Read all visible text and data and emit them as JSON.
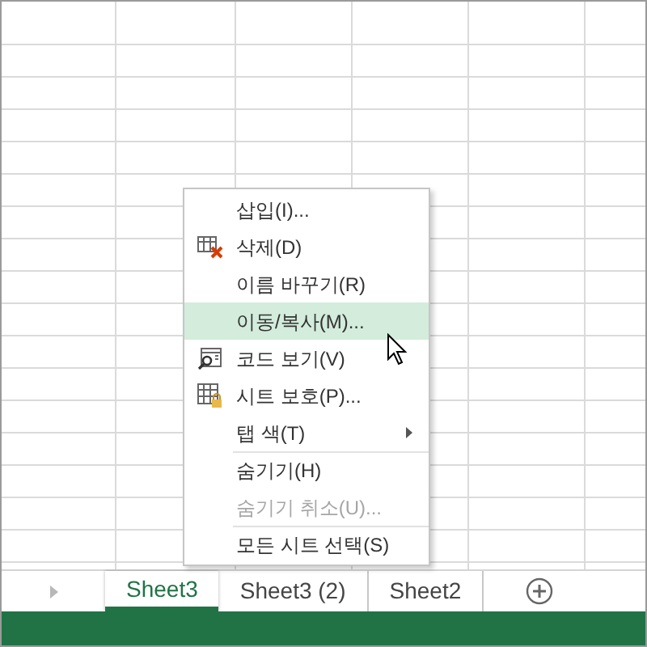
{
  "context_menu": {
    "items": [
      {
        "label": "삽입(I)...",
        "kind": "plain",
        "disabled": false,
        "selected": false,
        "submenu": false,
        "separator_before": false
      },
      {
        "label": "삭제(D)",
        "kind": "delete",
        "disabled": false,
        "selected": false,
        "submenu": false,
        "separator_before": false
      },
      {
        "label": "이름 바꾸기(R)",
        "kind": "plain",
        "disabled": false,
        "selected": false,
        "submenu": false,
        "separator_before": false
      },
      {
        "label": "이동/복사(M)...",
        "kind": "plain",
        "disabled": false,
        "selected": true,
        "submenu": false,
        "separator_before": false
      },
      {
        "label": "코드 보기(V)",
        "kind": "code",
        "disabled": false,
        "selected": false,
        "submenu": false,
        "separator_before": false
      },
      {
        "label": "시트 보호(P)...",
        "kind": "protect",
        "disabled": false,
        "selected": false,
        "submenu": false,
        "separator_before": false
      },
      {
        "label": "탭 색(T)",
        "kind": "plain",
        "disabled": false,
        "selected": false,
        "submenu": true,
        "separator_before": false
      },
      {
        "label": "숨기기(H)",
        "kind": "plain",
        "disabled": false,
        "selected": false,
        "submenu": false,
        "separator_before": true
      },
      {
        "label": "숨기기 취소(U)...",
        "kind": "plain",
        "disabled": true,
        "selected": false,
        "submenu": false,
        "separator_before": false
      },
      {
        "label": "모든 시트 선택(S)",
        "kind": "plain",
        "disabled": false,
        "selected": false,
        "submenu": false,
        "separator_before": true
      }
    ]
  },
  "sheet_tabs": [
    {
      "label": "Sheet3",
      "selected": true
    },
    {
      "label": "Sheet3 (2)",
      "selected": false
    },
    {
      "label": "Sheet2",
      "selected": false
    }
  ]
}
